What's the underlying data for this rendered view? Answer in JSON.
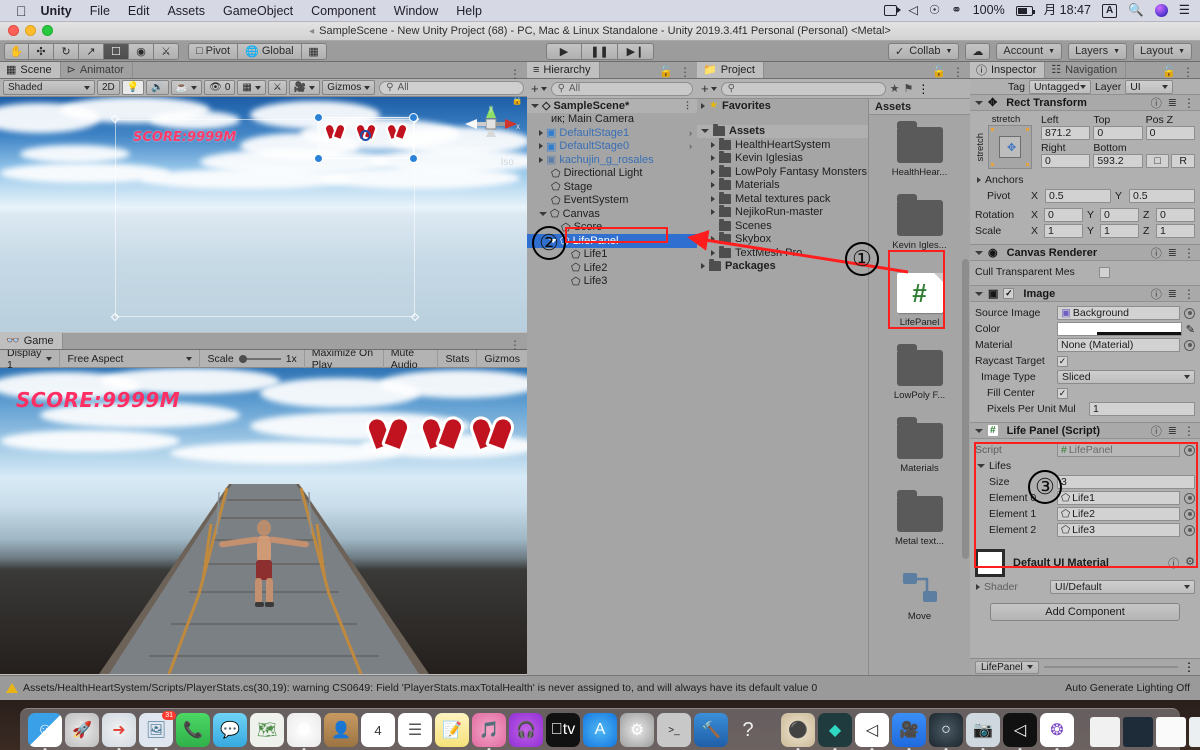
{
  "macbar": {
    "apple": "apple-logo",
    "menus": [
      "Unity",
      "File",
      "Edit",
      "Assets",
      "GameObject",
      "Component",
      "Window",
      "Help"
    ],
    "battery_percent": "100%",
    "clock": "月 18:47",
    "input_badge": "A",
    "status_icons": [
      "screen-record-icon",
      "discord-icon",
      "podcast-icon",
      "dropbox-icon",
      "battery-icon",
      "keyboard-input-icon",
      "search-icon",
      "siri-icon",
      "control-center-icon"
    ]
  },
  "titlebar": {
    "text": "SampleScene - New Unity Project (68) - PC, Mac & Linux Standalone - Unity 2019.3.4f1 Personal (Personal) <Metal>"
  },
  "toolbar": {
    "transform_tools": [
      "hand-tool",
      "move-tool",
      "rotate-tool",
      "scale-tool",
      "rect-tool",
      "transform-tool",
      "custom-editor-tool"
    ],
    "pivot_label": "Pivot",
    "global_label": "Global",
    "play_controls": [
      "play-button",
      "pause-button",
      "step-button"
    ],
    "collab_label": "Collab",
    "cloud_label": "cloud-button",
    "account_label": "Account",
    "layers_label": "Layers",
    "layout_label": "Layout"
  },
  "scene": {
    "tabs": [
      {
        "label": "Scene",
        "active": true
      },
      {
        "label": "Animator",
        "active": false
      }
    ],
    "shading_mode": "Shaded",
    "mode_2d": "2D",
    "audio_count": "0",
    "gizmos_label": "Gizmos",
    "search_placeholder": "All",
    "score_text": "SCORE:9999M",
    "gizmo_axis_labels": {
      "y": "y",
      "x": "x",
      "persp": "Iso"
    }
  },
  "game": {
    "tab_label": "Game",
    "display": "Display 1",
    "aspect": "Free Aspect",
    "scale_label": "Scale",
    "scale_value": "1x",
    "maximize": "Maximize On Play",
    "mute": "Mute Audio",
    "stats": "Stats",
    "gizmos": "Gizmos",
    "score_text": "SCORE:9999M"
  },
  "hierarchy": {
    "tab_label": "Hierarchy",
    "search_placeholder": "All",
    "scene_name": "SampleScene*",
    "items": [
      {
        "label": "Main Camera",
        "depth": 1,
        "type": "gameobject",
        "expandable": false
      },
      {
        "label": "DefaultStage1",
        "depth": 1,
        "type": "prefab",
        "expandable": true,
        "chevron": true
      },
      {
        "label": "DefaultStage0",
        "depth": 1,
        "type": "prefab",
        "expandable": true,
        "chevron": true
      },
      {
        "label": "kachujin_g_rosales",
        "depth": 1,
        "type": "prefab",
        "expandable": true,
        "chevron": false
      },
      {
        "label": "Directional Light",
        "depth": 1,
        "type": "gameobject",
        "expandable": false
      },
      {
        "label": "Stage",
        "depth": 1,
        "type": "gameobject",
        "expandable": false
      },
      {
        "label": "EventSystem",
        "depth": 1,
        "type": "gameobject",
        "expandable": false
      },
      {
        "label": "Canvas",
        "depth": 1,
        "type": "gameobject",
        "expandable": true,
        "expanded": true
      },
      {
        "label": "Score",
        "depth": 2,
        "type": "gameobject",
        "expandable": false
      },
      {
        "label": "LifePanel",
        "depth": 2,
        "type": "gameobject",
        "expandable": true,
        "expanded": true,
        "selected": true
      },
      {
        "label": "Life1",
        "depth": 3,
        "type": "gameobject",
        "expandable": false
      },
      {
        "label": "Life2",
        "depth": 3,
        "type": "gameobject",
        "expandable": false
      },
      {
        "label": "Life3",
        "depth": 3,
        "type": "gameobject",
        "expandable": false
      }
    ]
  },
  "project": {
    "tab_label": "Project",
    "search_placeholder": "",
    "favorites_label": "Favorites",
    "tree": [
      {
        "label": "Assets",
        "depth": 0,
        "bold": true,
        "expanded": true
      },
      {
        "label": "HealthHeartSystem",
        "depth": 1,
        "expandable": true
      },
      {
        "label": "Kevin Iglesias",
        "depth": 1,
        "expandable": true
      },
      {
        "label": "LowPoly Fantasy Monsters P",
        "depth": 1,
        "expandable": true
      },
      {
        "label": "Materials",
        "depth": 1,
        "expandable": true
      },
      {
        "label": "Metal textures pack",
        "depth": 1,
        "expandable": true
      },
      {
        "label": "NejikoRun-master",
        "depth": 1,
        "expandable": true
      },
      {
        "label": "Scenes",
        "depth": 1,
        "expandable": false
      },
      {
        "label": "Skybox",
        "depth": 1,
        "expandable": true
      },
      {
        "label": "TextMesh Pro",
        "depth": 1,
        "expandable": true
      },
      {
        "label": "Packages",
        "depth": 0,
        "bold": true,
        "expandable": true
      }
    ],
    "grid_header": "Assets",
    "grid_items": [
      {
        "label": "HealthHear...",
        "type": "folder"
      },
      {
        "label": "Kevin Igles...",
        "type": "folder"
      },
      {
        "label": "LifePanel",
        "type": "cs-script",
        "highlighted": true
      },
      {
        "label": "LowPoly F...",
        "type": "folder"
      },
      {
        "label": "Materials",
        "type": "folder"
      },
      {
        "label": "Metal text...",
        "type": "folder"
      },
      {
        "label": "Move",
        "type": "prefab"
      }
    ]
  },
  "inspector": {
    "tabs": [
      {
        "label": "Inspector",
        "active": true
      },
      {
        "label": "Navigation",
        "active": false
      }
    ],
    "tag_label": "Tag",
    "tag_value": "Untagged",
    "layer_label": "Layer",
    "layer_value": "UI",
    "rect_transform": {
      "title": "Rect Transform",
      "anchor_preset_top": "stretch",
      "anchor_preset_left": "stretch",
      "left_label": "Left",
      "left_value": "871.2",
      "top_label": "Top",
      "top_value": "0",
      "posz_label": "Pos Z",
      "posz_value": "0",
      "right_label": "Right",
      "right_value": "0",
      "bottom_label": "Bottom",
      "bottom_value": "593.2",
      "blueprint_label": "R",
      "anchors_label": "Anchors",
      "pivot_label": "Pivot",
      "pivot_x": "0.5",
      "pivot_y": "0.5",
      "rotation_label": "Rotation",
      "rot_x": "0",
      "rot_y": "0",
      "rot_z": "0",
      "scale_label": "Scale",
      "scale_x": "1",
      "scale_y": "1",
      "scale_z": "1"
    },
    "canvas_renderer": {
      "title": "Canvas Renderer",
      "cull_label": "Cull Transparent Mes",
      "cull_checked": false
    },
    "image": {
      "title": "Image",
      "enabled": true,
      "source_image_label": "Source Image",
      "source_image_value": "Background",
      "color_label": "Color",
      "material_label": "Material",
      "material_value": "None (Material)",
      "raycast_label": "Raycast Target",
      "raycast_checked": true,
      "image_type_label": "Image Type",
      "image_type_value": "Sliced",
      "fill_center_label": "Fill Center",
      "fill_center_checked": true,
      "ppu_label": "Pixels Per Unit Mul",
      "ppu_value": "1"
    },
    "life_panel": {
      "title": "Life Panel (Script)",
      "script_label": "Script",
      "script_value": "LifePanel",
      "lifes_label": "Lifes",
      "size_label": "Size",
      "size_value": "3",
      "elements": [
        {
          "label": "Element 0",
          "value": "Life1"
        },
        {
          "label": "Element 1",
          "value": "Life2"
        },
        {
          "label": "Element 2",
          "value": "Life3"
        }
      ]
    },
    "material": {
      "title": "Default UI Material",
      "shader_label": "Shader",
      "shader_value": "UI/Default"
    },
    "add_component": "Add Component",
    "footer_name": "LifePanel"
  },
  "statusbar": {
    "warning": "Assets/HealthHeartSystem/Scripts/PlayerStats.cs(30,19): warning CS0649: Field 'PlayerStats.maxTotalHealth' is never assigned to, and will always have its default value 0",
    "right": "Auto Generate Lighting Off"
  },
  "callouts": [
    {
      "number": "①",
      "target": "project-asset-lifepanel"
    },
    {
      "number": "②",
      "target": "hierarchy-lifepanel"
    },
    {
      "number": "③",
      "target": "inspector-life-panel-script"
    }
  ],
  "colors": {
    "accent_red": "#ff1d1d",
    "selection_blue": "#2f6fd0",
    "prefab_blue": "#3a6fb5",
    "warning_yellow": "#e8b417",
    "score_pink": "#ff2f63",
    "heart_red": "#c1121f",
    "cs_green": "#2f7d32"
  }
}
